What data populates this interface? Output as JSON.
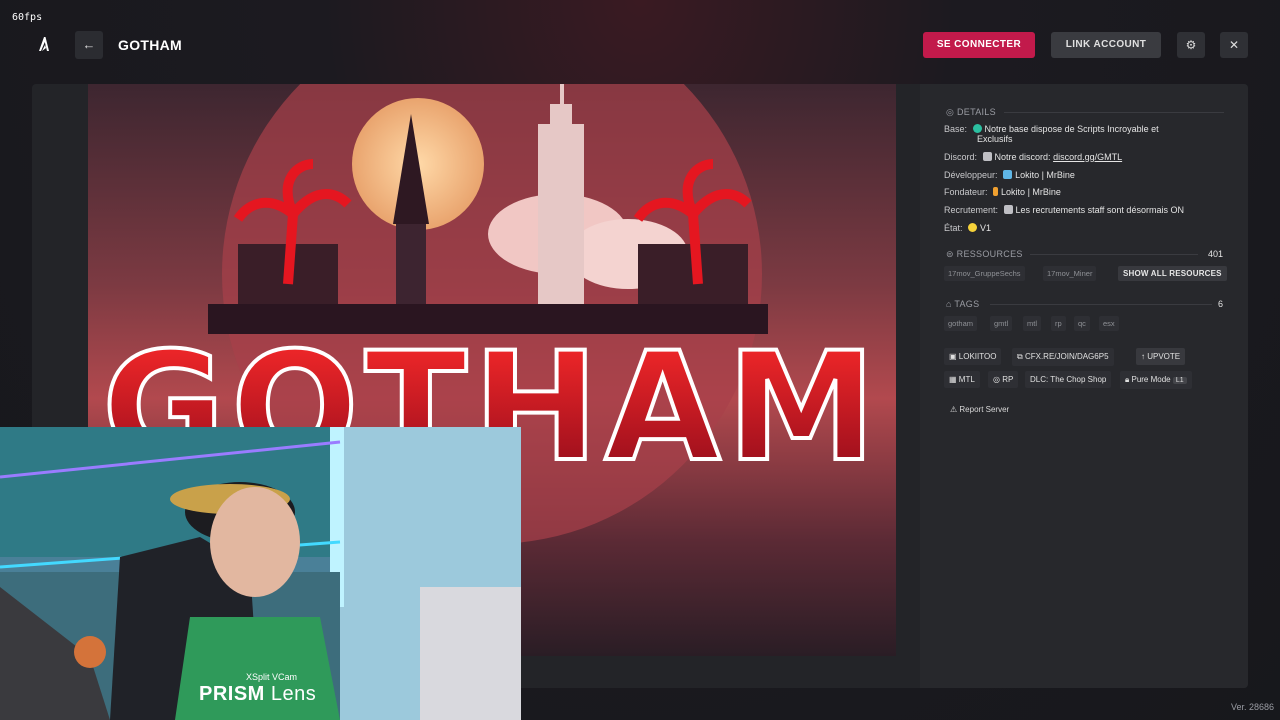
{
  "overlay": {
    "fps": "60fps"
  },
  "header": {
    "title": "GOTHAM",
    "back_icon": "arrow-left-icon",
    "connect_label": "SE CONNECTER",
    "link_label": "LINK ACCOUNT",
    "gear_icon": "gear-icon",
    "close_icon": "close-icon",
    "accent": "#c21a4b"
  },
  "banner": {
    "text": "GOTHAM"
  },
  "details": {
    "heading": "DETAILS",
    "rows": [
      {
        "key": "Base:",
        "value_line1": "Notre base dispose de Scripts Incroyable et",
        "value_line2": "Exclusifs"
      },
      {
        "key": "Discord:",
        "value_prefix": "Notre discord:",
        "value_link": "discord.gg/GMTL"
      },
      {
        "key": "Développeur:",
        "value": "Lokito | MrBine"
      },
      {
        "key": "Fondateur:",
        "value": "Lokito | MrBine"
      },
      {
        "key": "Recrutement:",
        "value": "Les recrutements staff sont désormais ON"
      },
      {
        "key": "État:",
        "value": "V1"
      }
    ]
  },
  "resources": {
    "heading": "RESSOURCES",
    "count": "401",
    "items": [
      "17mov_GruppeSechs",
      "17mov_Miner"
    ],
    "show_all_label": "SHOW ALL RESOURCES"
  },
  "tags": {
    "heading": "TAGS",
    "count": "6",
    "items": [
      "gotham",
      "gmtl",
      "mtl",
      "rp",
      "qc",
      "esx"
    ]
  },
  "actions": {
    "owner": "LOKIITOO",
    "join": "CFX.RE/JOIN/DAG6P5",
    "upvote": "UPVOTE",
    "locale": "MTL",
    "gametype": "RP",
    "dlc": "DLC: The Chop Shop",
    "pure_mode": "Pure Mode",
    "pure_level": "L1",
    "report": "Report Server"
  },
  "footer": {
    "version": "Ver. 28686"
  },
  "webcam": {
    "brand_small": "XSplit VCam",
    "brand_bold": "PRISM",
    "brand_light": "Lens"
  }
}
